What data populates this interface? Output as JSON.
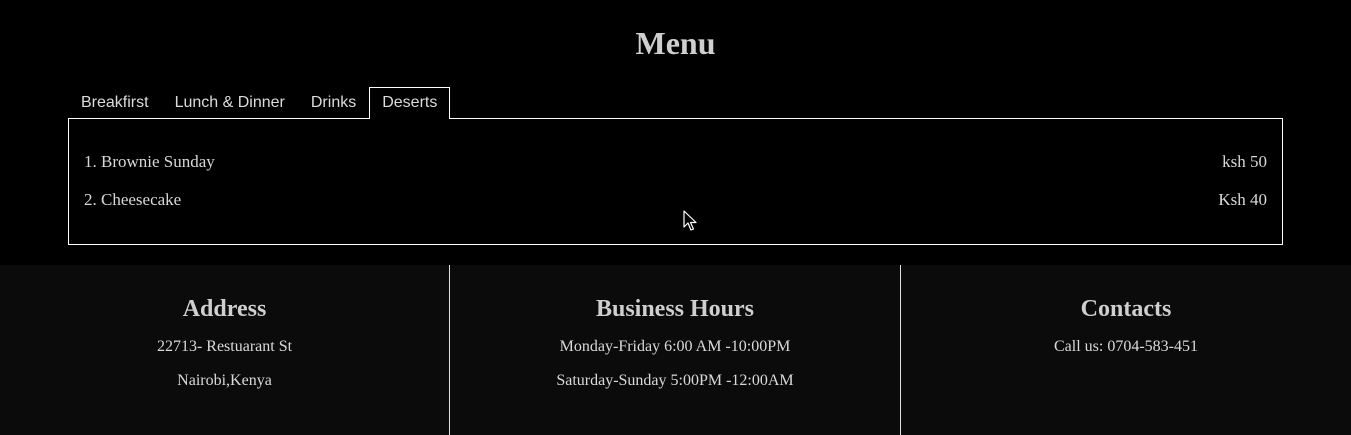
{
  "menu": {
    "title": "Menu",
    "tabs": [
      {
        "label": "Breakfirst",
        "active": false
      },
      {
        "label": "Lunch & Dinner",
        "active": false
      },
      {
        "label": "Drinks",
        "active": false
      },
      {
        "label": "Deserts",
        "active": true
      }
    ],
    "items": [
      {
        "name": "1. Brownie Sunday",
        "price": "ksh 50"
      },
      {
        "name": "2. Cheesecake",
        "price": "Ksh 40"
      }
    ]
  },
  "footer": {
    "address": {
      "heading": "Address",
      "lines": [
        "22713- Restuarant St",
        "Nairobi,Kenya"
      ]
    },
    "hours": {
      "heading": "Business Hours",
      "lines": [
        "Monday-Friday 6:00 AM -10:00PM",
        "Saturday-Sunday 5:00PM -12:00AM"
      ]
    },
    "contacts": {
      "heading": "Contacts",
      "lines": [
        "Call us: 0704-583-451"
      ]
    }
  },
  "colors": {
    "background": "#000000",
    "footer_background": "#0b0b0b",
    "border": "#ffffff"
  },
  "icons": {
    "cursor": "mouse-pointer-icon"
  }
}
